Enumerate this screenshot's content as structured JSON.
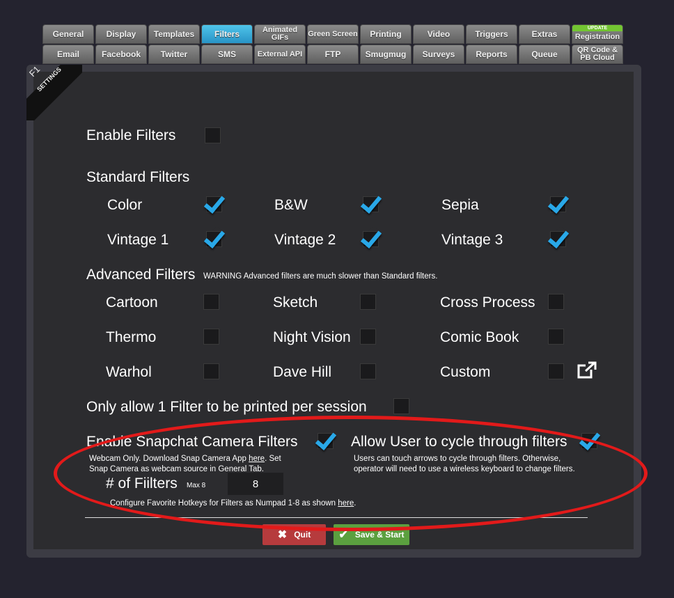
{
  "tabs_row1": [
    {
      "label": "General"
    },
    {
      "label": "Display"
    },
    {
      "label": "Templates"
    },
    {
      "label": "Filters"
    },
    {
      "label": "Animated GIFs"
    },
    {
      "label": "Green Screen"
    },
    {
      "label": "Printing"
    },
    {
      "label": "Video"
    },
    {
      "label": "Triggers"
    },
    {
      "label": "Extras"
    },
    {
      "label": "Registration",
      "badge": "UPDATE"
    }
  ],
  "tabs_row2": [
    {
      "label": "Email"
    },
    {
      "label": "Facebook"
    },
    {
      "label": "Twitter"
    },
    {
      "label": "SMS"
    },
    {
      "label": "External API"
    },
    {
      "label": "FTP"
    },
    {
      "label": "Smugmug"
    },
    {
      "label": "Surveys"
    },
    {
      "label": "Reports"
    },
    {
      "label": "Queue"
    },
    {
      "label": "QR Code & PB Cloud"
    }
  ],
  "ribbon": {
    "key": "F1",
    "text": "SETTINGS"
  },
  "enable_filters": {
    "label": "Enable Filters",
    "checked": false
  },
  "standard": {
    "title": "Standard Filters",
    "items": [
      {
        "label": "Color",
        "checked": true
      },
      {
        "label": "B&W",
        "checked": true
      },
      {
        "label": "Sepia",
        "checked": true
      },
      {
        "label": "Vintage 1",
        "checked": true
      },
      {
        "label": "Vintage 2",
        "checked": true
      },
      {
        "label": "Vintage 3",
        "checked": true
      }
    ]
  },
  "advanced": {
    "title": "Advanced Filters",
    "warning": "WARNING Advanced filters are much slower than Standard filters.",
    "items": [
      {
        "label": "Cartoon",
        "checked": false
      },
      {
        "label": "Sketch",
        "checked": false
      },
      {
        "label": "Cross Process",
        "checked": false
      },
      {
        "label": "Thermo",
        "checked": false
      },
      {
        "label": "Night Vision",
        "checked": false
      },
      {
        "label": "Comic Book",
        "checked": false
      },
      {
        "label": "Warhol",
        "checked": false
      },
      {
        "label": "Dave Hill",
        "checked": false
      },
      {
        "label": "Custom",
        "checked": false
      }
    ]
  },
  "only_one": {
    "label": "Only allow 1 Filter to be printed per session",
    "checked": false
  },
  "snapchat": {
    "label": "Enable Snapchat Camera Filters",
    "checked": true,
    "desc_a": "Webcam Only. Download Snap Camera App ",
    "desc_link": "here",
    "desc_b": ". Set",
    "desc_line2": "Snap Camera as webcam source in General Tab."
  },
  "cycle": {
    "label": "Allow User to cycle through filters",
    "checked": true,
    "desc_line1": "Users can touch arrows to cycle through filters.  Otherwise,",
    "desc_line2": "operator will need to use a wireless keyboard to change filters."
  },
  "num_filters": {
    "label": "# of Fiilters",
    "max": "Max 8",
    "value": "8"
  },
  "hotkeys": {
    "text": "Configure Favorite Hotkeys for Filters as Numpad 1-8 as shown ",
    "link": "here",
    "end": "."
  },
  "buttons": {
    "quit": "Quit",
    "save": "Save & Start"
  }
}
